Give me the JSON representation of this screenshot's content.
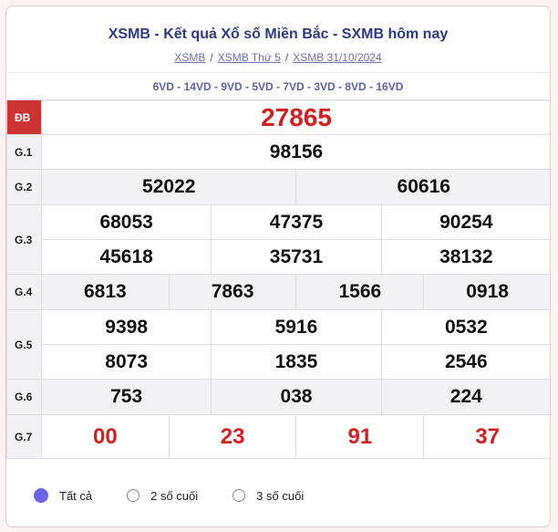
{
  "header": {
    "title": "XSMB - Kết quả Xổ số Miền Bắc - SXMB hôm nay",
    "breadcrumb": [
      "XSMB",
      "XSMB Thứ 5",
      "XSMB 31/10/2024"
    ],
    "codes": "6VD - 14VD - 9VD - 5VD - 7VD - 3VD - 8VD - 16VD"
  },
  "prizes": {
    "db": {
      "label": "ĐB",
      "numbers": [
        "27865"
      ]
    },
    "g1": {
      "label": "G.1",
      "numbers": [
        "98156"
      ]
    },
    "g2": {
      "label": "G.2",
      "numbers": [
        "52022",
        "60616"
      ]
    },
    "g3": {
      "label": "G.3",
      "numbers": [
        "68053",
        "47375",
        "90254",
        "45618",
        "35731",
        "38132"
      ]
    },
    "g4": {
      "label": "G.4",
      "numbers": [
        "6813",
        "7863",
        "1566",
        "0918"
      ]
    },
    "g5": {
      "label": "G.5",
      "numbers": [
        "9398",
        "5916",
        "0532",
        "8073",
        "1835",
        "2546"
      ]
    },
    "g6": {
      "label": "G.6",
      "numbers": [
        "753",
        "038",
        "224"
      ]
    },
    "g7": {
      "label": "G.7",
      "numbers": [
        "00",
        "23",
        "91",
        "37"
      ]
    }
  },
  "filters": {
    "selected": 0,
    "options": [
      "Tất cả",
      "2 số cuối",
      "3 số cuối"
    ]
  },
  "colors": {
    "accent": "#d41f1f",
    "title": "#2b3a8a",
    "radio": "#6c63e8"
  }
}
